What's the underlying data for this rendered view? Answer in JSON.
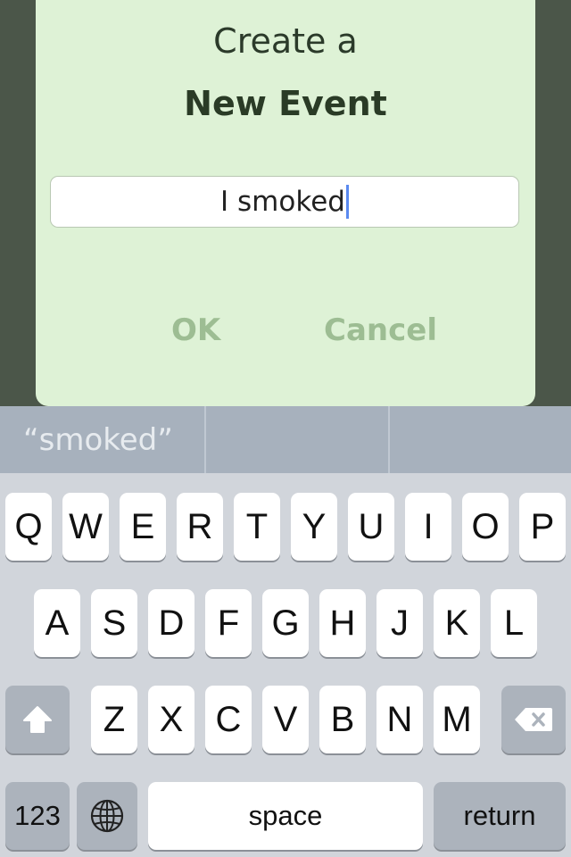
{
  "dialog": {
    "line1": "Create a",
    "line2": "New Event",
    "field_value": "I smoked",
    "ok_label": "OK",
    "cancel_label": "Cancel"
  },
  "suggestions": [
    "“smoked”",
    "",
    ""
  ],
  "keyboard": {
    "row1": [
      "Q",
      "W",
      "E",
      "R",
      "T",
      "Y",
      "U",
      "I",
      "O",
      "P"
    ],
    "row2": [
      "A",
      "S",
      "D",
      "F",
      "G",
      "H",
      "J",
      "K",
      "L"
    ],
    "row3": [
      "Z",
      "X",
      "C",
      "V",
      "B",
      "N",
      "M"
    ],
    "numbers_label": "123",
    "space_label": "space",
    "return_label": "return",
    "shift_icon": "shift-arrow-icon",
    "delete_icon": "backspace-icon",
    "globe_icon": "globe-icon"
  },
  "colors": {
    "backdrop": "#4b5649",
    "dialog_bg": "#def2d6",
    "button_text": "#9dbd93",
    "caret": "#5a8af0"
  }
}
